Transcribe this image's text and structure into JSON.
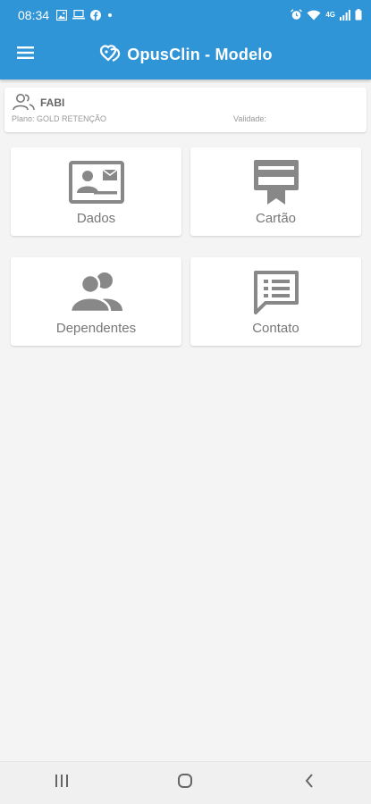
{
  "status_bar": {
    "time": "08:34",
    "network": "4G",
    "icons": [
      "image-icon",
      "laptop-icon",
      "facebook-icon",
      "dot-icon",
      "alarm-icon",
      "wifi-icon",
      "signal-icon",
      "battery-icon"
    ]
  },
  "app_bar": {
    "title": "OpusClin - Modelo",
    "menu_icon": "hamburger-menu-icon",
    "logo_icon": "opusclin-logo-icon",
    "color": "#2f95d6"
  },
  "user_card": {
    "name": "FABI",
    "plan": "Plano: GOLD RETENÇÃO",
    "validade": "Validade:"
  },
  "tiles": [
    {
      "label": "Dados",
      "icon": "id-card-icon"
    },
    {
      "label": "Cartão",
      "icon": "card-icon"
    },
    {
      "label": "Dependentes",
      "icon": "users-icon"
    },
    {
      "label": "Contato",
      "icon": "message-icon"
    }
  ],
  "nav_bar": {
    "icons": [
      "recent-apps-icon",
      "home-icon",
      "back-icon"
    ]
  }
}
